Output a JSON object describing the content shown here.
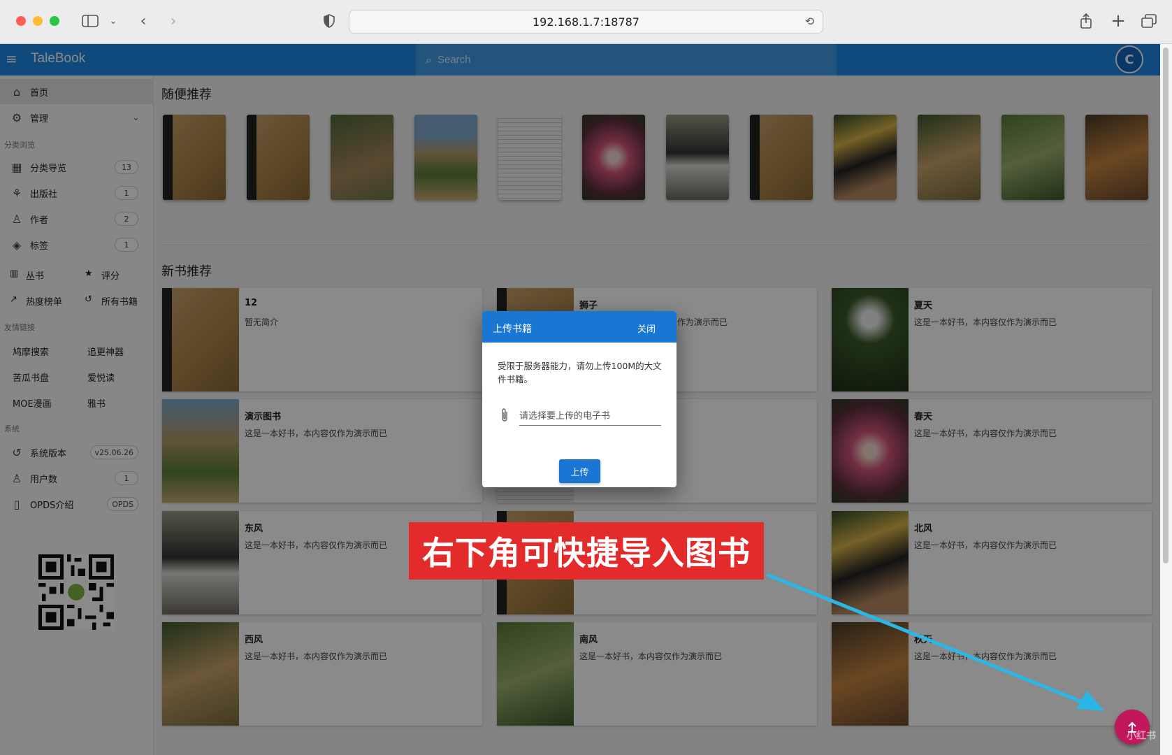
{
  "browser": {
    "url": "192.168.1.7:18787"
  },
  "app": {
    "brand": "TaleBook",
    "search_placeholder": "Search",
    "avatar_letter": "C"
  },
  "sidebar": {
    "home": "首页",
    "manage": "管理",
    "section_browse": "分类浏览",
    "category_nav": "分类导览",
    "category_count": "13",
    "publisher": "出版社",
    "publisher_count": "1",
    "author": "作者",
    "author_count": "2",
    "tag": "标签",
    "tag_count": "1",
    "series": "丛书",
    "rating": "评分",
    "hot_list": "热度榜单",
    "all_books": "所有书籍",
    "section_links": "友情链接",
    "link1": "鸠摩搜索",
    "link2": "追更神器",
    "link3": "苦瓜书盘",
    "link4": "爱悦读",
    "link5": "MOE漫画",
    "link6": "雅书",
    "section_system": "系统",
    "sys_version": "系统版本",
    "sys_version_value": "v25.06.26",
    "users": "用户数",
    "users_count": "1",
    "opds": "OPDS介绍",
    "opds_badge": "OPDS"
  },
  "main": {
    "random_title": "随便推荐",
    "new_title": "新书推荐",
    "cards": [
      {
        "title": "12",
        "desc": "暂无简介"
      },
      {
        "title": "狮子",
        "desc": "作为演示而已"
      },
      {
        "title": "夏天",
        "desc": "这是一本好书，本内容仅作为演示而已"
      },
      {
        "title": "演示图书",
        "desc": "这是一本好书，本内容仅作为演示而已"
      },
      {
        "title": "春天",
        "desc": "这是一本好书，本内容仅作为演示而已"
      },
      {
        "title": "东风",
        "desc": "这是一本好书，本内容仅作为演示而已"
      },
      {
        "title": "北风",
        "desc": "这是一本好书，本内容仅作为演示而已"
      },
      {
        "title": "西风",
        "desc": "这是一本好书，本内容仅作为演示而已"
      },
      {
        "title": "南风",
        "desc": "这是一本好书，本内容仅作为演示而已"
      },
      {
        "title": "秋天",
        "desc": "这是一本好书，本内容仅作为演示而已"
      }
    ]
  },
  "dialog": {
    "title": "上传书籍",
    "close": "关闭",
    "message": "受限于服务器能力，请勿上传100M的大文件书籍。",
    "file_placeholder": "请选择要上传的电子书",
    "upload": "上传"
  },
  "annotation": {
    "banner": "右下角可快捷导入图书",
    "watermark": "小红书"
  },
  "colors": {
    "primary": "#1e88e5",
    "banner": "#e32b2b",
    "fab": "#c2185b",
    "arrow": "#2bb7e6"
  }
}
